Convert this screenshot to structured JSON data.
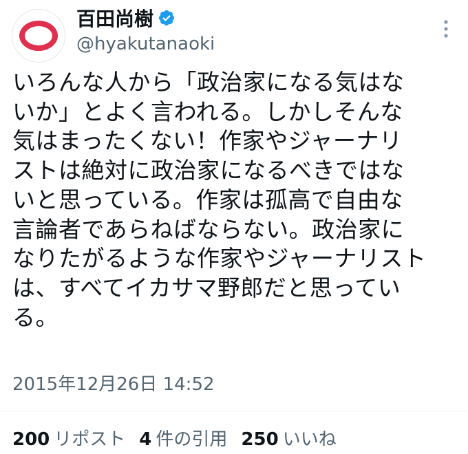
{
  "author": {
    "display_name": "百田尚樹",
    "handle": "@hyakutanaoki",
    "verified": true,
    "avatar": "red-ring-logo",
    "verified_icon": "verified-badge-icon"
  },
  "more_icon": "more-options-icon",
  "tweet": {
    "lines": [
      "いろんな人から「政治家になる気はな",
      "いか」とよく言われる。しかしそんな",
      "気はまったくない！作家やジャーナリ",
      "ストは絶対に政治家になるべきではな",
      "いと思っている。作家は孤高で自由な",
      "言論者であらねばならない。政治家に",
      "なりたがるような作家やジャーナリスト",
      "は、すべてイカサマ野郎だと思ってい",
      "る。"
    ],
    "timestamp": "2015年12月26日 14:52"
  },
  "stats": {
    "reposts": {
      "count": "200",
      "label": "リポスト"
    },
    "quotes": {
      "count": "4",
      "label": "件の引用"
    },
    "likes": {
      "count": "250",
      "label": "いいね"
    }
  },
  "colors": {
    "brand_red": "#e0304f",
    "verified_blue": "#1d9bf0",
    "text_primary": "#0f1419",
    "text_secondary": "#536471"
  }
}
